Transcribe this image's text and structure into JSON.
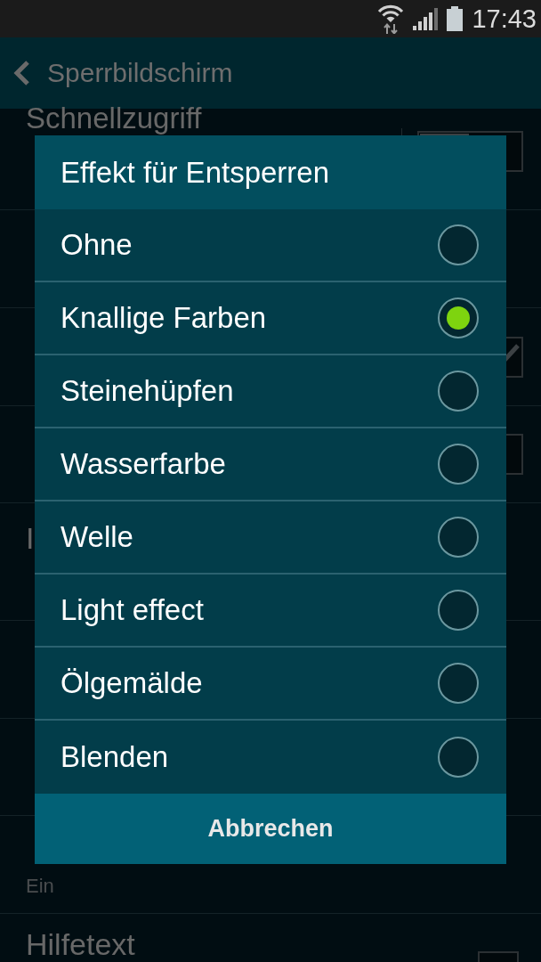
{
  "status_bar": {
    "time": "17:43"
  },
  "header": {
    "title": "Sperrbildschirm"
  },
  "settings": [
    {
      "title": "Schnellzugriff",
      "control": {
        "kind": "switch",
        "on": false
      }
    },
    {
      "control": {
        "kind": "checkbox",
        "checked": true
      }
    },
    {
      "control": {
        "kind": "checkbox",
        "checked": false
      }
    },
    {
      "title": "I"
    },
    {
      "subtitles": [
        "Ein"
      ]
    },
    {
      "title": "Hilfetext",
      "control": {
        "kind": "checkbox",
        "checked": false
      }
    }
  ],
  "dialog": {
    "title": "Effekt für Entsperren",
    "options": [
      {
        "label": "Ohne",
        "selected": false
      },
      {
        "label": "Knallige Farben",
        "selected": true
      },
      {
        "label": "Steinehüpfen",
        "selected": false
      },
      {
        "label": "Wasserfarbe",
        "selected": false
      },
      {
        "label": "Welle",
        "selected": false
      },
      {
        "label": "Light effect",
        "selected": false
      },
      {
        "label": "Ölgemälde",
        "selected": false
      },
      {
        "label": "Blenden",
        "selected": false
      }
    ],
    "button": "Abbrechen"
  }
}
